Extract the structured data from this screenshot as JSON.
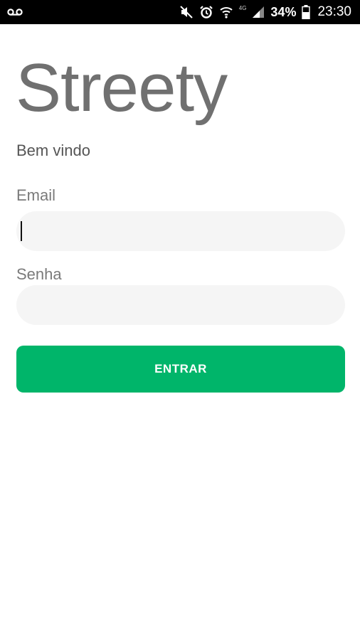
{
  "status_bar": {
    "left_icon": "voicemail-icon",
    "icons": [
      "mute-icon",
      "alarm-icon",
      "wifi-icon",
      "signal-icon",
      "battery-icon"
    ],
    "network_type": "4G",
    "battery_percent": "34%",
    "time": "23:30"
  },
  "app": {
    "title": "Streety",
    "welcome": "Bem vindo"
  },
  "form": {
    "email_label": "Email",
    "email_value": "",
    "password_label": "Senha",
    "password_value": "",
    "submit_label": "ENTRAR"
  },
  "colors": {
    "status_bar_bg": "#000000",
    "title": "#707070",
    "input_bg": "#f5f5f5",
    "accent": "#00b56a"
  }
}
